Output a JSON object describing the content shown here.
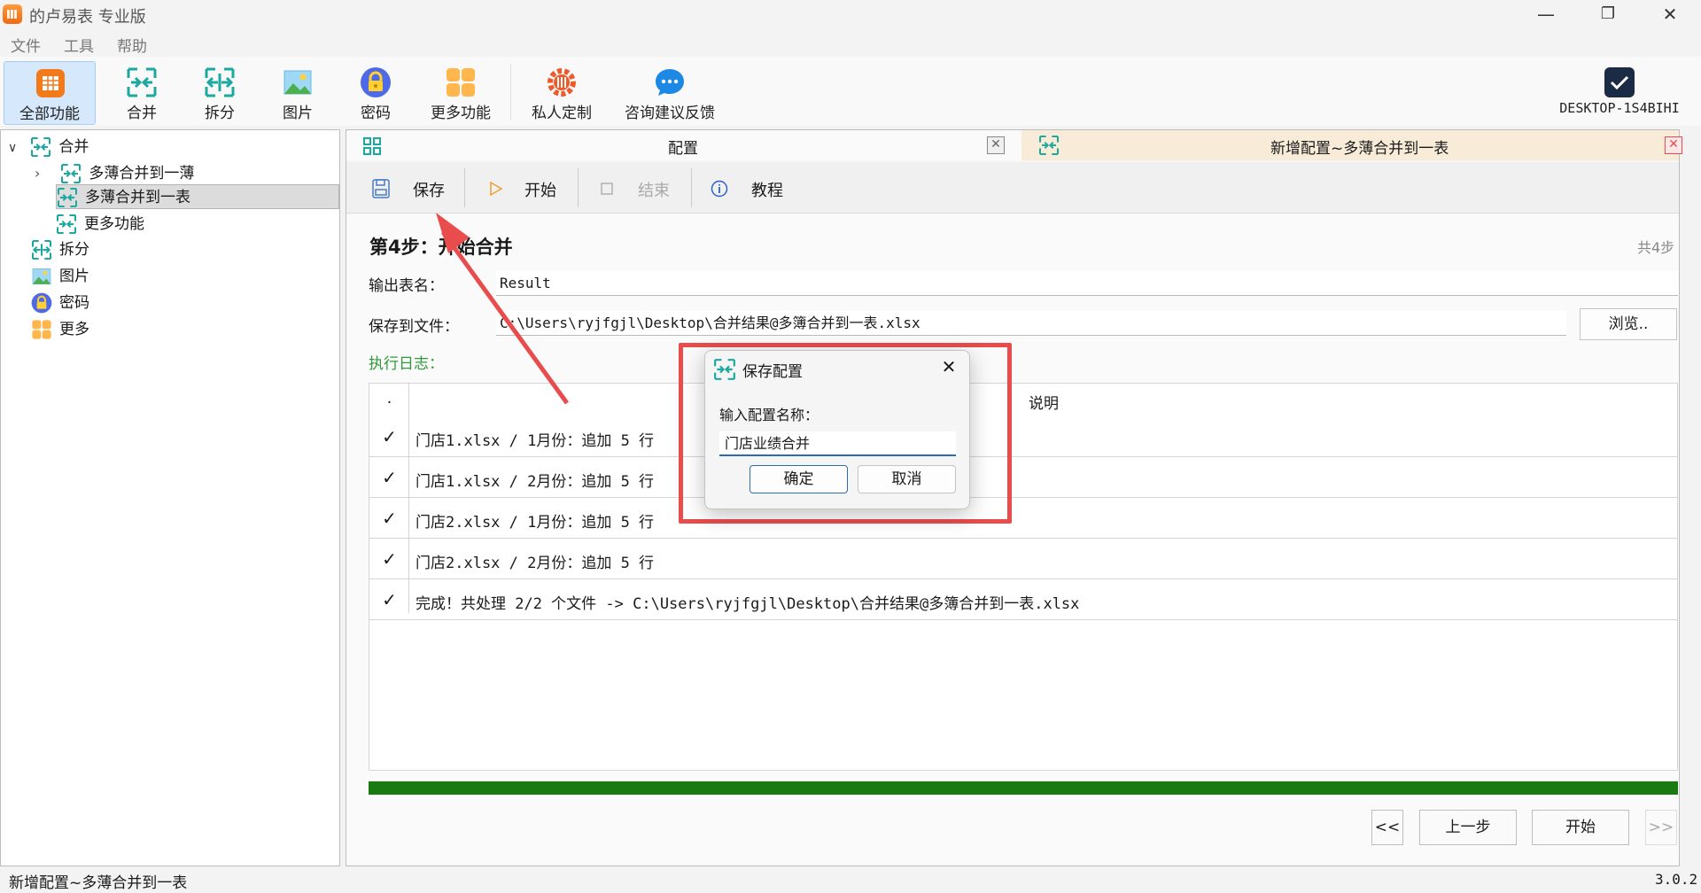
{
  "window": {
    "title": "的卢易表 专业版",
    "minimize_glyph": "—",
    "maximize_glyph": "❐",
    "close_glyph": "✕"
  },
  "menu": {
    "file": "文件",
    "tools": "工具",
    "help": "帮助"
  },
  "ribbon": {
    "all": "全部功能",
    "merge": "合并",
    "split": "拆分",
    "image": "图片",
    "password": "密码",
    "more": "更多功能",
    "custom": "私人定制",
    "feedback": "咨询建议反馈",
    "device": "DESKTOP-1S4BIHI"
  },
  "tree": {
    "merge": "合并",
    "merge_to_book": "多薄合并到一薄",
    "merge_to_sheet": "多薄合并到一表",
    "merge_more": "更多功能",
    "split": "拆分",
    "image": "图片",
    "password": "密码",
    "more": "更多",
    "expand_glyph": "∨",
    "collapse_glyph": "›"
  },
  "tabs": {
    "config": "配置",
    "new_config": "新增配置~多薄合并到一表",
    "close_glyph": "✕"
  },
  "toolbar": {
    "save": "保存",
    "start": "开始",
    "stop": "结束",
    "tutorial": "教程"
  },
  "step": {
    "title": "第4步：开始合并",
    "total": "共4步"
  },
  "form": {
    "output_label": "输出表名：",
    "output_value": "Result",
    "save_label": "保存到文件：",
    "save_value": "C:\\Users\\ryjfgjl\\Desktop\\合并结果@多簿合并到一表.xlsx",
    "browse": "浏览..",
    "log_label": "执行日志："
  },
  "log": {
    "header_dot": ".",
    "header_desc": "说明",
    "check": "✓",
    "rows": [
      "门店1.xlsx / 1月份：追加 5 行",
      "门店1.xlsx / 2月份：追加 5 行",
      "门店2.xlsx / 1月份：追加 5 行",
      "门店2.xlsx / 2月份：追加 5 行",
      "完成！共处理 2/2 个文件 -> C:\\Users\\ryjfgjl\\Desktop\\合并结果@多簿合并到一表.xlsx"
    ]
  },
  "progress": {
    "fraction": 1.0
  },
  "nav": {
    "first": "<<",
    "prev": "上一步",
    "start": "开始",
    "last": ">>"
  },
  "status": {
    "left": "新增配置~多薄合并到一表",
    "version": "3.0.2"
  },
  "dialog": {
    "title": "保存配置",
    "close_glyph": "✕",
    "label": "输入配置名称：",
    "value": "门店业绩合并",
    "ok": "确定",
    "cancel": "取消"
  },
  "colors": {
    "accent": "#1aa8a0",
    "highlight": "#e84c4c",
    "progress": "#1a7a12",
    "tab_active": "#f8ecd9"
  }
}
